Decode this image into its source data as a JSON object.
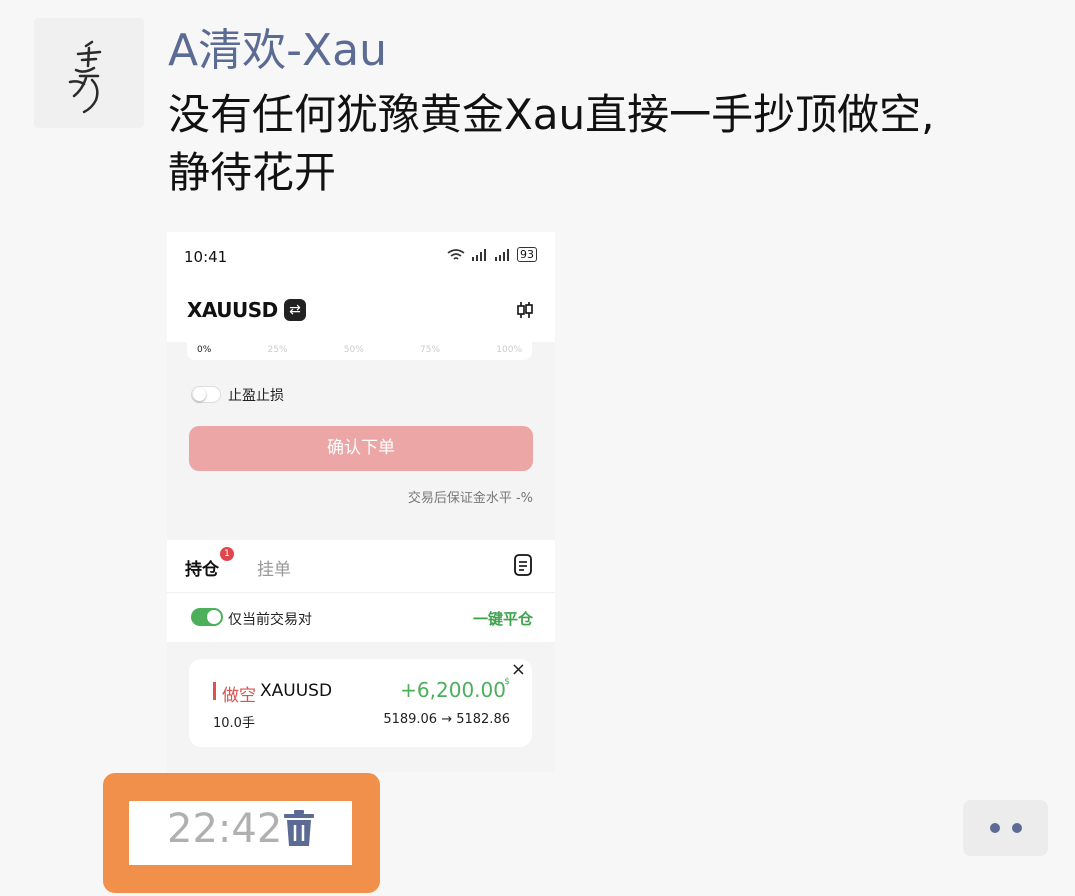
{
  "post": {
    "username": "A清欢-Xau",
    "text_line1": "没有任何犹豫黄金Xau直接一手抄顶做空,",
    "text_line2": "静待花开",
    "timestamp": "22:42"
  },
  "screenshot": {
    "status_time": "10:41",
    "battery": "93",
    "symbol": "XAUUSD",
    "slider_labels": [
      "0%",
      "25%",
      "50%",
      "75%",
      "100%"
    ],
    "tp_sl_label": "止盈止损",
    "confirm_button": "确认下单",
    "margin_note": "交易后保证金水平 -%",
    "tabs": {
      "positions": "持仓",
      "positions_badge": "1",
      "pending": "挂单"
    },
    "filter_label": "仅当前交易对",
    "close_all": "一键平仓",
    "position": {
      "side": "做空",
      "symbol": "XAUUSD",
      "pnl": "+6,200.00",
      "currency": "$",
      "lots": "10.0手",
      "prices": "5189.06 → 5182.86",
      "close_glyph": "×"
    }
  },
  "colors": {
    "username": "#5b6b93",
    "highlight": "#f1904b",
    "short": "#d9534f",
    "profit": "#4cb05b",
    "confirm_button": "#eca6a6"
  },
  "icons": [
    "avatar-calligraphy",
    "swap-icon",
    "candlestick-icon",
    "document-icon",
    "close-icon",
    "trash-icon",
    "more-dots-icon"
  ]
}
